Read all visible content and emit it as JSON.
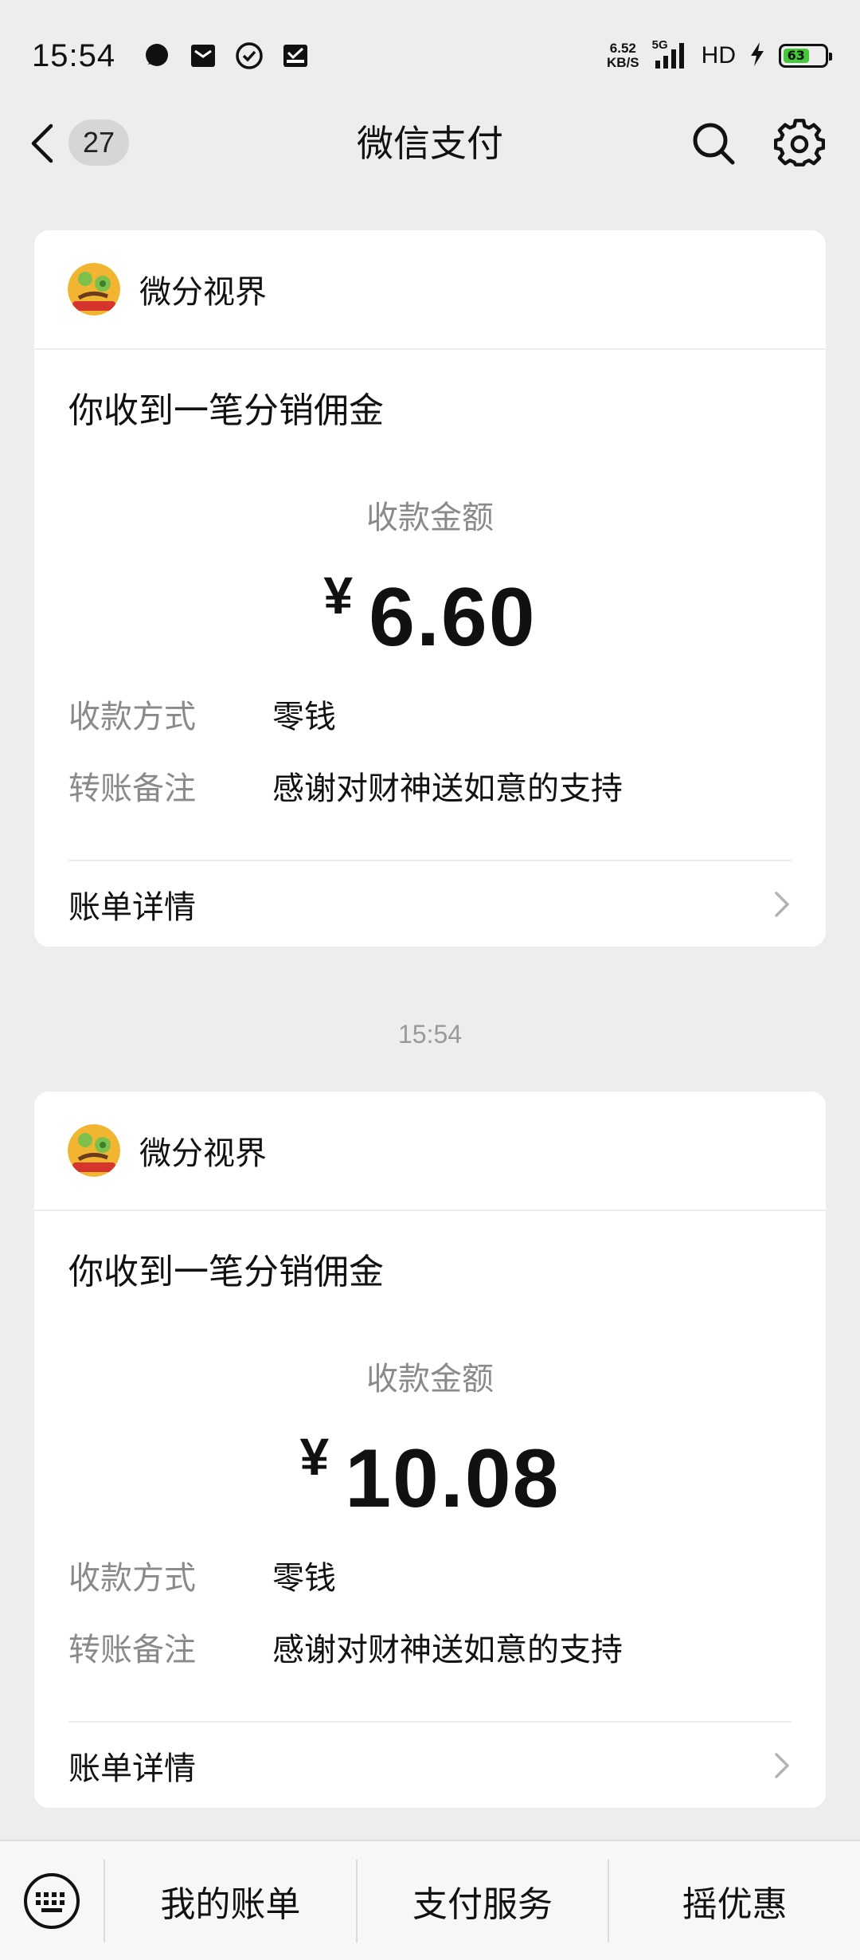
{
  "status_bar": {
    "time": "15:54",
    "notification_icons": [
      "chat-bubble-icon",
      "mail-icon",
      "check-circle-icon",
      "inbox-icon"
    ],
    "net_speed_value": "6.52",
    "net_speed_unit": "KB/S",
    "network": "5G",
    "hd": "HD",
    "charging_icon": "bolt-icon",
    "battery_percent": "63",
    "battery_level": 0.63,
    "battery_color": "#45c93a"
  },
  "navbar": {
    "back_icon": "chevron-left-icon",
    "unread_count": "27",
    "title": "微信支付",
    "search_icon": "search-icon",
    "settings_icon": "gear-icon"
  },
  "messages": [
    {
      "merchant": "微分视界",
      "title": "你收到一笔分销佣金",
      "amount_label": "收款金额",
      "currency": "¥",
      "amount": "6.60",
      "fields": [
        {
          "label": "收款方式",
          "value": "零钱"
        },
        {
          "label": "转账备注",
          "value": "感谢对财神送如意的支持"
        }
      ],
      "detail_label": "账单详情"
    },
    {
      "merchant": "微分视界",
      "title": "你收到一笔分销佣金",
      "amount_label": "收款金额",
      "currency": "¥",
      "amount": "10.08",
      "fields": [
        {
          "label": "收款方式",
          "value": "零钱"
        },
        {
          "label": "转账备注",
          "value": "感谢对财神送如意的支持"
        }
      ],
      "detail_label": "账单详情"
    }
  ],
  "timestamp": "15:54",
  "bottom_bar": {
    "keyboard_icon": "keyboard-icon",
    "items": [
      "我的账单",
      "支付服务",
      "摇优惠"
    ]
  }
}
